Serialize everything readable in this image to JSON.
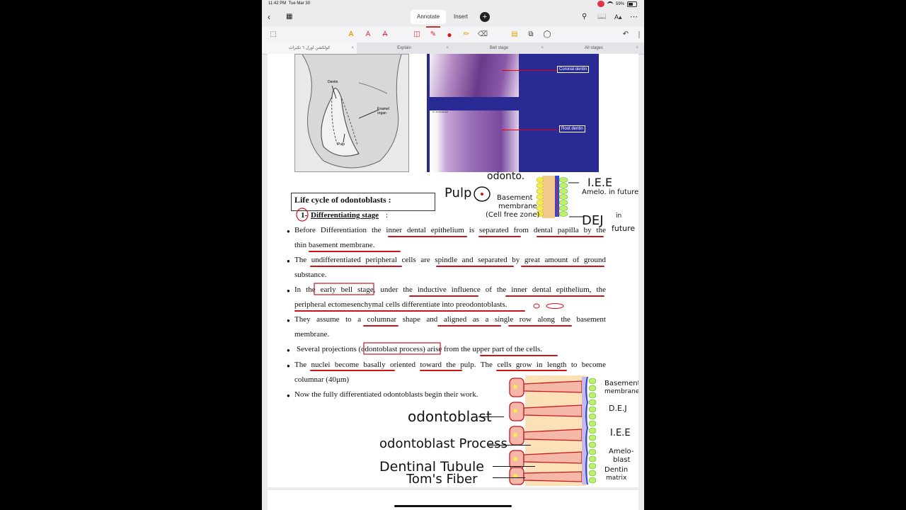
{
  "status": {
    "time": "11:42 PM",
    "date": "Tue Mar 30",
    "battery": "59%"
  },
  "nav": {
    "annotate": "Annotate",
    "insert": "Insert",
    "plus": "+"
  },
  "doc_tabs": [
    "كولكشن اورل ٦ تكبرات",
    "Explain",
    "Bell stage",
    "All stages"
  ],
  "figures": {
    "left_labels": [
      "Dentin",
      "Enamel organ",
      "Pulp"
    ],
    "coronal": "Coronal dentin",
    "root": "Root dentin",
    "small_caption": "Dr. Ali Abdalmed"
  },
  "section": {
    "title": "Life cycle of odontoblasts :",
    "subtitle_num": "1-",
    "subtitle": "Differentiating stage",
    "subtitle_colon": ":"
  },
  "bullets": [
    [
      "Before Differentiation the inner dental epithelium is separated from dental papilla by the",
      "thin basement membrane."
    ],
    [
      "The undifferentiated peripheral cells are spindle and separated by great amount of ground",
      "substance."
    ],
    [
      "In the early bell stage, under the inductive influence of the inner dental epithelium, the",
      "peripheral ectomesenchymal cells differentiate into preodontoblasts."
    ],
    [
      "They assume to a columnar shape and aligned as a single row along the basement",
      "membrane."
    ],
    [
      "Several projections (odontoblast process) arise from the upper part of the cells."
    ],
    [
      "The nuclei become basally oriented toward the pulp. The cells grow in length to become",
      "columnar (40μm)"
    ],
    [
      "Now the fully differentiated odontoblasts begin their work."
    ]
  ],
  "handwriting": {
    "odonto": "odonto.",
    "pulp": "Pulp",
    "basement": "Basement",
    "membrane": "membrane",
    "cell_free": "(Cell free zone)",
    "iee": "I.E.E",
    "amelo_future": "Amelo. in future",
    "dej": "DEJ",
    "in": "in",
    "future": "future",
    "odontoblast": "odontoblast",
    "process": "odontoblast Process",
    "tubule": "Dentinal Tubule",
    "toms": "Tom's Fiber",
    "r_basement": "Basement",
    "r_membrane": "membrane",
    "r_dej": "D.E.J",
    "r_iee": "I.E.E",
    "r_amelo": "Amelo-",
    "r_blast": "blast",
    "r_dentin": "Dentin",
    "r_matrix": "matrix"
  },
  "colors": {
    "accent": "#c8161c",
    "slide_bg": "#2a2a95"
  }
}
